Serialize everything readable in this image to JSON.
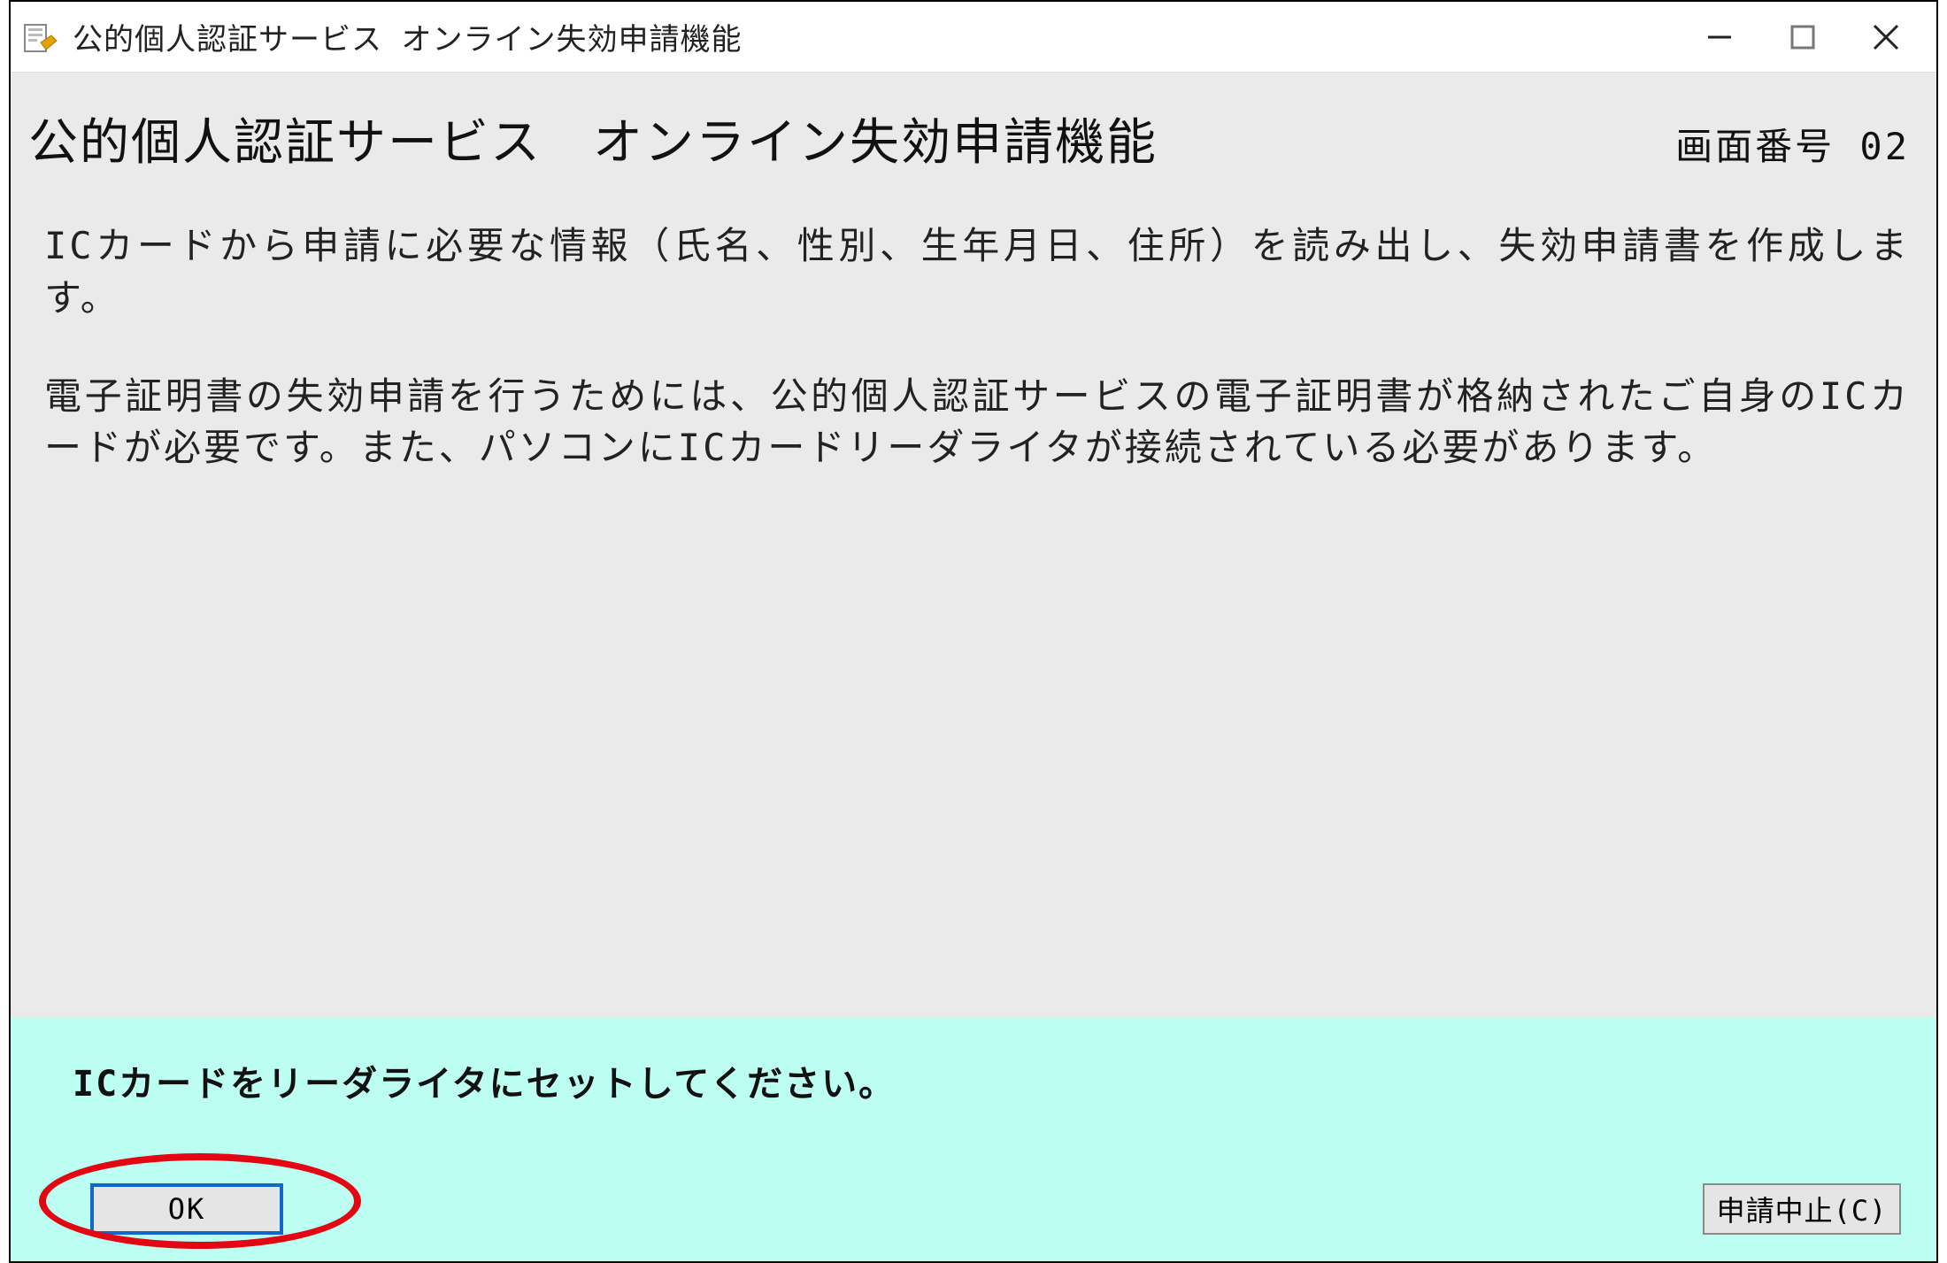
{
  "window": {
    "title": "公的個人認証サービス オンライン失効申請機能"
  },
  "page": {
    "title": "公的個人認証サービス　オンライン失効申請機能",
    "screen_number": "画面番号 02",
    "paragraph1": "ICカードから申請に必要な情報（氏名、性別、生年月日、住所）を読み出し、失効申請書を作成します。",
    "paragraph2": "電子証明書の失効申請を行うためには、公的個人認証サービスの電子証明書が格納されたご自身のICカードが必要です。また、パソコンにICカードリーダライタが接続されている必要があります。"
  },
  "footer": {
    "instruction": "ICカードをリーダライタにセットしてください。",
    "ok_label": "OK",
    "cancel_label": "申請中止(C)"
  }
}
